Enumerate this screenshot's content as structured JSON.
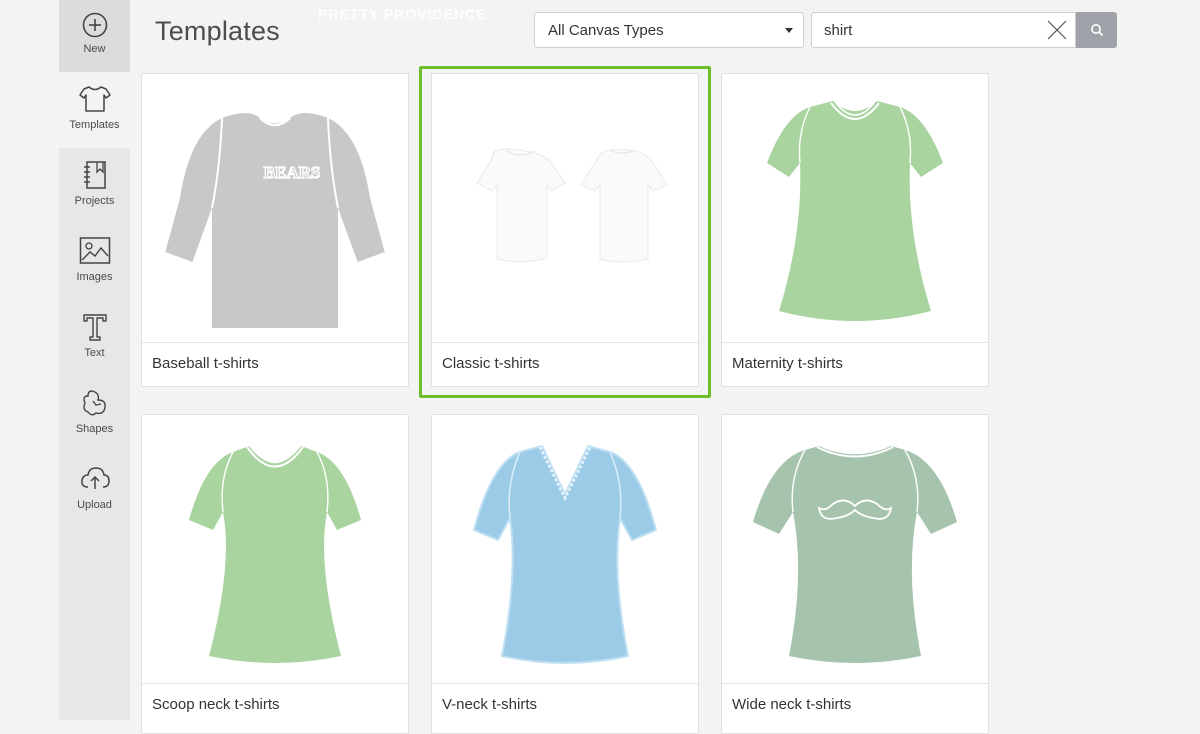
{
  "sidebar": {
    "items": [
      {
        "label": "New",
        "icon": "plus-circle-icon"
      },
      {
        "label": "Templates",
        "icon": "tshirt-icon"
      },
      {
        "label": "Projects",
        "icon": "notebook-icon"
      },
      {
        "label": "Images",
        "icon": "image-icon"
      },
      {
        "label": "Text",
        "icon": "text-T-icon"
      },
      {
        "label": "Shapes",
        "icon": "shapes-icon"
      },
      {
        "label": "Upload",
        "icon": "cloud-upload-icon"
      }
    ],
    "active": "Templates"
  },
  "header": {
    "title": "Templates",
    "watermark": "PRETTY PROVIDENCE",
    "canvas_type_select": {
      "value": "All Canvas Types"
    },
    "search": {
      "value": "shirt"
    }
  },
  "templates": [
    {
      "label": "Baseball t-shirts",
      "color": "#c8c8c8",
      "text": "BEARS"
    },
    {
      "label": "Classic t-shirts",
      "color": "#ffffff",
      "selected": true
    },
    {
      "label": "Maternity t-shirts",
      "color": "#a9d49f"
    },
    {
      "label": "Scoop neck t-shirts",
      "color": "#a9d49f"
    },
    {
      "label": "V-neck t-shirts",
      "color": "#9ccbe8"
    },
    {
      "label": "Wide neck t-shirts",
      "color": "#a6c4ad"
    }
  ],
  "colors": {
    "selected_outline": "#6cbf2a",
    "search_button": "#9fa2a8"
  }
}
